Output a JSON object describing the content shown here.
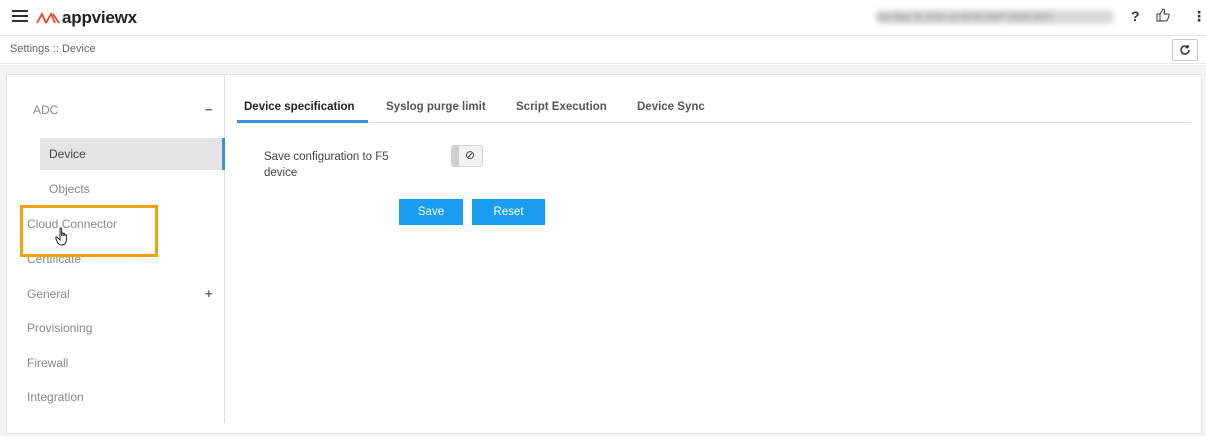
{
  "header": {
    "logo_text": "appviewx",
    "datetime_obscured": "Tue May 31 2022 11:00:00 GMT+0530 (IST)",
    "help_glyph": "?",
    "thumb_glyph": "👍",
    "kebab_glyph": "⋮"
  },
  "breadcrumb": {
    "text": "Settings :: Device"
  },
  "sidebar": {
    "items": [
      {
        "label": "ADC",
        "toggle": "−"
      },
      {
        "label": "Device"
      },
      {
        "label": "Objects"
      },
      {
        "label": "Cloud Connector"
      },
      {
        "label": "Certificate"
      },
      {
        "label": "General",
        "toggle": "+"
      },
      {
        "label": "Provisioning"
      },
      {
        "label": "Firewall"
      },
      {
        "label": "Integration"
      }
    ]
  },
  "tabs": [
    {
      "label": "Device specification"
    },
    {
      "label": "Syslog purge limit"
    },
    {
      "label": "Script Execution"
    },
    {
      "label": "Device Sync"
    }
  ],
  "form": {
    "field_label": "Save configuration to F5 device",
    "toggle_glyph": "⊘",
    "toggle_state": "off",
    "save_label": "Save",
    "reset_label": "Reset"
  },
  "colors": {
    "accent": "#3a95d8",
    "button": "#1a9df0",
    "highlight": "#f0a30a"
  }
}
